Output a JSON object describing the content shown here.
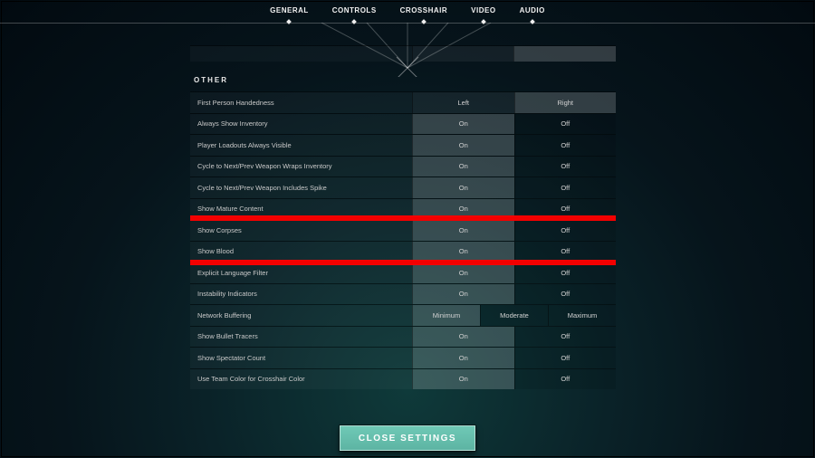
{
  "nav": {
    "tabs": [
      "GENERAL",
      "CONTROLS",
      "CROSSHAIR",
      "VIDEO",
      "AUDIO"
    ],
    "active": 0
  },
  "section_other_title": "OTHER",
  "rows": [
    {
      "label": "First Person Handedness",
      "opts": [
        "Left",
        "Right"
      ],
      "selected": 1
    },
    {
      "label": "Always Show Inventory",
      "opts": [
        "On",
        "Off"
      ],
      "selected": 0
    },
    {
      "label": "Player Loadouts Always Visible",
      "opts": [
        "On",
        "Off"
      ],
      "selected": 0
    },
    {
      "label": "Cycle to Next/Prev Weapon Wraps Inventory",
      "opts": [
        "On",
        "Off"
      ],
      "selected": 0
    },
    {
      "label": "Cycle to Next/Prev Weapon Includes Spike",
      "opts": [
        "On",
        "Off"
      ],
      "selected": 0
    },
    {
      "label": "Show Mature Content",
      "opts": [
        "On",
        "Off"
      ],
      "selected": 0
    },
    {
      "label": "Show Corpses",
      "opts": [
        "On",
        "Off"
      ],
      "selected": 0
    },
    {
      "label": "Show Blood",
      "opts": [
        "On",
        "Off"
      ],
      "selected": 0
    },
    {
      "label": "Explicit Language Filter",
      "opts": [
        "On",
        "Off"
      ],
      "selected": 0
    },
    {
      "label": "Instability Indicators",
      "opts": [
        "On",
        "Off"
      ],
      "selected": 0
    },
    {
      "label": "Network Buffering",
      "opts": [
        "Minimum",
        "Moderate",
        "Maximum"
      ],
      "selected": 0
    },
    {
      "label": "Show Bullet Tracers",
      "opts": [
        "On",
        "Off"
      ],
      "selected": 0
    },
    {
      "label": "Show Spectator Count",
      "opts": [
        "On",
        "Off"
      ],
      "selected": 0
    },
    {
      "label": "Use Team Color for Crosshair Color",
      "opts": [
        "On",
        "Off"
      ],
      "selected": 0
    }
  ],
  "highlighted_rows": [
    6,
    7
  ],
  "close_button": "CLOSE SETTINGS"
}
